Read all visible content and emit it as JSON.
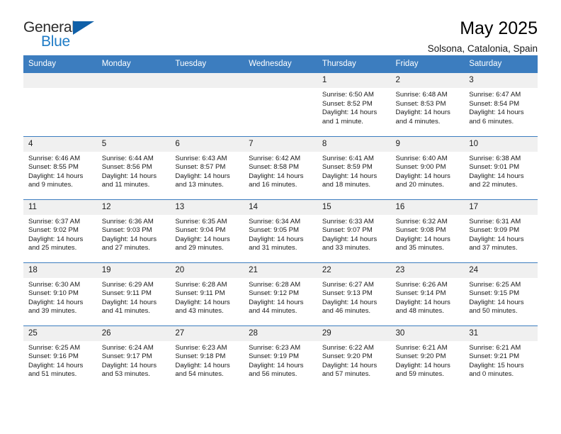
{
  "brand": {
    "name_part1": "General",
    "name_part2": "Blue",
    "triangle_color": "#1060a8",
    "blue_text_color": "#1f7cc6"
  },
  "header": {
    "title": "May 2025",
    "subtitle": "Solsona, Catalonia, Spain",
    "header_bg": "#3c7dbf",
    "daynum_bg": "#f0f0f0"
  },
  "weekday_headers": [
    "Sunday",
    "Monday",
    "Tuesday",
    "Wednesday",
    "Thursday",
    "Friday",
    "Saturday"
  ],
  "labels": {
    "sunrise": "Sunrise:",
    "sunset": "Sunset:",
    "daylight": "Daylight:"
  },
  "weeks": [
    [
      {
        "day": "",
        "empty": true
      },
      {
        "day": "",
        "empty": true
      },
      {
        "day": "",
        "empty": true
      },
      {
        "day": "",
        "empty": true
      },
      {
        "day": "1",
        "sunrise": "Sunrise: 6:50 AM",
        "sunset": "Sunset: 8:52 PM",
        "daylight_line1": "Daylight: 14 hours",
        "daylight_line2": "and 1 minute."
      },
      {
        "day": "2",
        "sunrise": "Sunrise: 6:48 AM",
        "sunset": "Sunset: 8:53 PM",
        "daylight_line1": "Daylight: 14 hours",
        "daylight_line2": "and 4 minutes."
      },
      {
        "day": "3",
        "sunrise": "Sunrise: 6:47 AM",
        "sunset": "Sunset: 8:54 PM",
        "daylight_line1": "Daylight: 14 hours",
        "daylight_line2": "and 6 minutes."
      }
    ],
    [
      {
        "day": "4",
        "sunrise": "Sunrise: 6:46 AM",
        "sunset": "Sunset: 8:55 PM",
        "daylight_line1": "Daylight: 14 hours",
        "daylight_line2": "and 9 minutes."
      },
      {
        "day": "5",
        "sunrise": "Sunrise: 6:44 AM",
        "sunset": "Sunset: 8:56 PM",
        "daylight_line1": "Daylight: 14 hours",
        "daylight_line2": "and 11 minutes."
      },
      {
        "day": "6",
        "sunrise": "Sunrise: 6:43 AM",
        "sunset": "Sunset: 8:57 PM",
        "daylight_line1": "Daylight: 14 hours",
        "daylight_line2": "and 13 minutes."
      },
      {
        "day": "7",
        "sunrise": "Sunrise: 6:42 AM",
        "sunset": "Sunset: 8:58 PM",
        "daylight_line1": "Daylight: 14 hours",
        "daylight_line2": "and 16 minutes."
      },
      {
        "day": "8",
        "sunrise": "Sunrise: 6:41 AM",
        "sunset": "Sunset: 8:59 PM",
        "daylight_line1": "Daylight: 14 hours",
        "daylight_line2": "and 18 minutes."
      },
      {
        "day": "9",
        "sunrise": "Sunrise: 6:40 AM",
        "sunset": "Sunset: 9:00 PM",
        "daylight_line1": "Daylight: 14 hours",
        "daylight_line2": "and 20 minutes."
      },
      {
        "day": "10",
        "sunrise": "Sunrise: 6:38 AM",
        "sunset": "Sunset: 9:01 PM",
        "daylight_line1": "Daylight: 14 hours",
        "daylight_line2": "and 22 minutes."
      }
    ],
    [
      {
        "day": "11",
        "sunrise": "Sunrise: 6:37 AM",
        "sunset": "Sunset: 9:02 PM",
        "daylight_line1": "Daylight: 14 hours",
        "daylight_line2": "and 25 minutes."
      },
      {
        "day": "12",
        "sunrise": "Sunrise: 6:36 AM",
        "sunset": "Sunset: 9:03 PM",
        "daylight_line1": "Daylight: 14 hours",
        "daylight_line2": "and 27 minutes."
      },
      {
        "day": "13",
        "sunrise": "Sunrise: 6:35 AM",
        "sunset": "Sunset: 9:04 PM",
        "daylight_line1": "Daylight: 14 hours",
        "daylight_line2": "and 29 minutes."
      },
      {
        "day": "14",
        "sunrise": "Sunrise: 6:34 AM",
        "sunset": "Sunset: 9:05 PM",
        "daylight_line1": "Daylight: 14 hours",
        "daylight_line2": "and 31 minutes."
      },
      {
        "day": "15",
        "sunrise": "Sunrise: 6:33 AM",
        "sunset": "Sunset: 9:07 PM",
        "daylight_line1": "Daylight: 14 hours",
        "daylight_line2": "and 33 minutes."
      },
      {
        "day": "16",
        "sunrise": "Sunrise: 6:32 AM",
        "sunset": "Sunset: 9:08 PM",
        "daylight_line1": "Daylight: 14 hours",
        "daylight_line2": "and 35 minutes."
      },
      {
        "day": "17",
        "sunrise": "Sunrise: 6:31 AM",
        "sunset": "Sunset: 9:09 PM",
        "daylight_line1": "Daylight: 14 hours",
        "daylight_line2": "and 37 minutes."
      }
    ],
    [
      {
        "day": "18",
        "sunrise": "Sunrise: 6:30 AM",
        "sunset": "Sunset: 9:10 PM",
        "daylight_line1": "Daylight: 14 hours",
        "daylight_line2": "and 39 minutes."
      },
      {
        "day": "19",
        "sunrise": "Sunrise: 6:29 AM",
        "sunset": "Sunset: 9:11 PM",
        "daylight_line1": "Daylight: 14 hours",
        "daylight_line2": "and 41 minutes."
      },
      {
        "day": "20",
        "sunrise": "Sunrise: 6:28 AM",
        "sunset": "Sunset: 9:11 PM",
        "daylight_line1": "Daylight: 14 hours",
        "daylight_line2": "and 43 minutes."
      },
      {
        "day": "21",
        "sunrise": "Sunrise: 6:28 AM",
        "sunset": "Sunset: 9:12 PM",
        "daylight_line1": "Daylight: 14 hours",
        "daylight_line2": "and 44 minutes."
      },
      {
        "day": "22",
        "sunrise": "Sunrise: 6:27 AM",
        "sunset": "Sunset: 9:13 PM",
        "daylight_line1": "Daylight: 14 hours",
        "daylight_line2": "and 46 minutes."
      },
      {
        "day": "23",
        "sunrise": "Sunrise: 6:26 AM",
        "sunset": "Sunset: 9:14 PM",
        "daylight_line1": "Daylight: 14 hours",
        "daylight_line2": "and 48 minutes."
      },
      {
        "day": "24",
        "sunrise": "Sunrise: 6:25 AM",
        "sunset": "Sunset: 9:15 PM",
        "daylight_line1": "Daylight: 14 hours",
        "daylight_line2": "and 50 minutes."
      }
    ],
    [
      {
        "day": "25",
        "sunrise": "Sunrise: 6:25 AM",
        "sunset": "Sunset: 9:16 PM",
        "daylight_line1": "Daylight: 14 hours",
        "daylight_line2": "and 51 minutes."
      },
      {
        "day": "26",
        "sunrise": "Sunrise: 6:24 AM",
        "sunset": "Sunset: 9:17 PM",
        "daylight_line1": "Daylight: 14 hours",
        "daylight_line2": "and 53 minutes."
      },
      {
        "day": "27",
        "sunrise": "Sunrise: 6:23 AM",
        "sunset": "Sunset: 9:18 PM",
        "daylight_line1": "Daylight: 14 hours",
        "daylight_line2": "and 54 minutes."
      },
      {
        "day": "28",
        "sunrise": "Sunrise: 6:23 AM",
        "sunset": "Sunset: 9:19 PM",
        "daylight_line1": "Daylight: 14 hours",
        "daylight_line2": "and 56 minutes."
      },
      {
        "day": "29",
        "sunrise": "Sunrise: 6:22 AM",
        "sunset": "Sunset: 9:20 PM",
        "daylight_line1": "Daylight: 14 hours",
        "daylight_line2": "and 57 minutes."
      },
      {
        "day": "30",
        "sunrise": "Sunrise: 6:21 AM",
        "sunset": "Sunset: 9:20 PM",
        "daylight_line1": "Daylight: 14 hours",
        "daylight_line2": "and 59 minutes."
      },
      {
        "day": "31",
        "sunrise": "Sunrise: 6:21 AM",
        "sunset": "Sunset: 9:21 PM",
        "daylight_line1": "Daylight: 15 hours",
        "daylight_line2": "and 0 minutes."
      }
    ]
  ]
}
